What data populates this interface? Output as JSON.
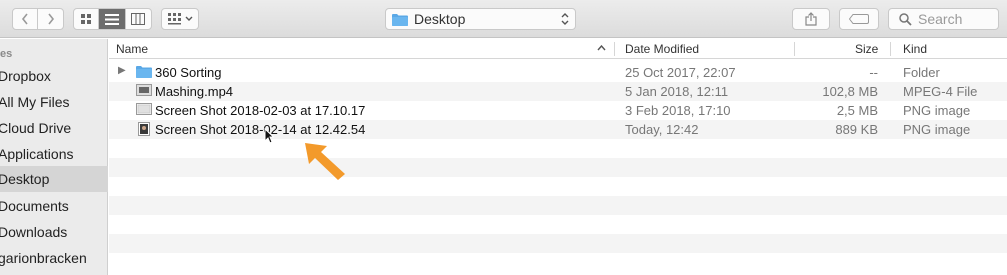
{
  "toolbar": {
    "path_label": "Desktop",
    "search_placeholder": "Search"
  },
  "sidebar": {
    "section_header": "es",
    "items": [
      {
        "label": "Dropbox"
      },
      {
        "label": "All My Files"
      },
      {
        "label": "Cloud Drive"
      },
      {
        "label": "Applications"
      },
      {
        "label": "Desktop",
        "selected": true
      },
      {
        "label": "Documents"
      },
      {
        "label": "Downloads"
      },
      {
        "label": "garionbracken"
      }
    ]
  },
  "columns": {
    "name": "Name",
    "date": "Date Modified",
    "size": "Size",
    "kind": "Kind"
  },
  "files": [
    {
      "name": "360 Sorting",
      "date": "25 Oct 2017, 22:07",
      "size": "--",
      "kind": "Folder",
      "icon": "folder-icon"
    },
    {
      "name": "Mashing.mp4",
      "date": "5 Jan 2018, 12:11",
      "size": "102,8 MB",
      "kind": "MPEG-4 File",
      "icon": "video-file-icon"
    },
    {
      "name": "Screen Shot 2018-02-03 at 17.10.17",
      "date": "3 Feb 2018, 17:10",
      "size": "2,5 MB",
      "kind": "PNG image",
      "icon": "image-file-icon"
    },
    {
      "name": "Screen Shot 2018-02-14 at 12.42.54",
      "date": "Today, 12:42",
      "size": "889 KB",
      "kind": "PNG image",
      "icon": "image-file-icon"
    }
  ],
  "colors": {
    "folder_blue": "#5aa8e6",
    "annotation_arrow": "#f39a2b",
    "sidebar_bg": "#ebebeb",
    "selected_bg": "#d5d5d5"
  }
}
